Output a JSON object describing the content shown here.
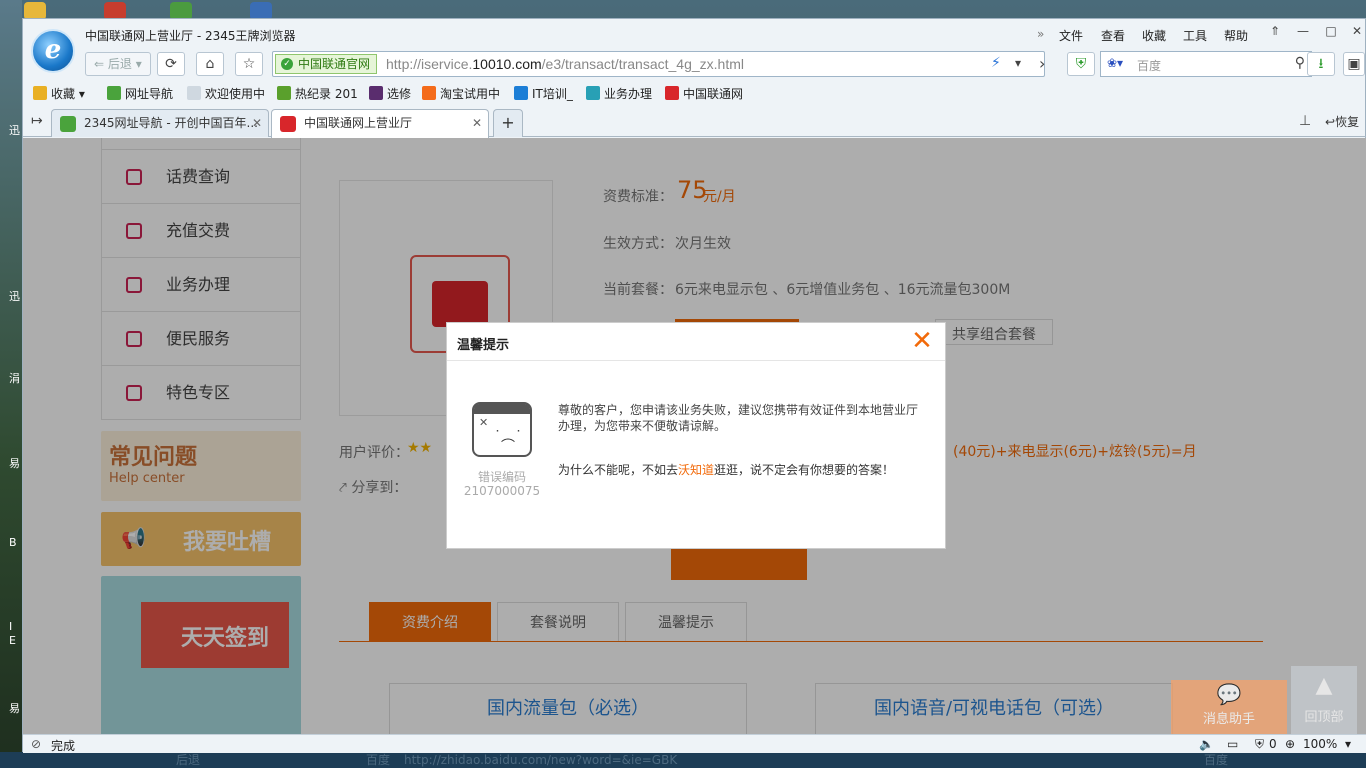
{
  "window": {
    "title": "中国联通网上营业厅 - 2345王牌浏览器",
    "menu": [
      "文件",
      "查看",
      "收藏",
      "工具",
      "帮助"
    ],
    "more_glyph": "»"
  },
  "navbar": {
    "back_label": "后退",
    "cert_label": "中国联通官网",
    "url_prefix": "http://iservice.",
    "url_domain": "10010.com",
    "url_suffix": "/e3/transact/transact_4g_zx.html",
    "search_placeholder": "百度"
  },
  "favorites": [
    {
      "label": "收藏",
      "color": "#e9b024"
    },
    {
      "label": "网址导航",
      "color": "#4aa33c"
    },
    {
      "label": "欢迎使用中",
      "color": "#cfd8e0"
    },
    {
      "label": "热纪录 201",
      "color": "#5aa02c"
    },
    {
      "label": "选修",
      "color": "#5a2d6e"
    },
    {
      "label": "淘宝试用中",
      "color": "#f46b1a"
    },
    {
      "label": "IT培训_",
      "color": "#1c7ed6"
    },
    {
      "label": "业务办理",
      "color": "#28a0b5"
    },
    {
      "label": "中国联通网",
      "color": "#d8262b"
    }
  ],
  "tabs": [
    {
      "label": "2345网址导航 - 开创中国百年...",
      "active": false
    },
    {
      "label": "中国联通网上营业厅",
      "active": true
    }
  ],
  "tabbar_right": {
    "restore_label": "恢复"
  },
  "sidebar": [
    {
      "label": "话费查询"
    },
    {
      "label": "充值交费"
    },
    {
      "label": "业务办理"
    },
    {
      "label": "便民服务"
    },
    {
      "label": "特色专区"
    }
  ],
  "promos": {
    "faq_title": "常见问题",
    "faq_sub": "Help center",
    "complain": "我要吐槽",
    "checkin": "天天签到"
  },
  "product": {
    "fee_label": "资费标准：",
    "fee_value": "75",
    "fee_unit": "元/月",
    "effect_label": "生效方式：",
    "effect_value": "次月生效",
    "current_label": "当前套餐：",
    "current_value": "6元来电显示包 、6元增值业务包 、16元流量包300M",
    "share_btn": "共享组合套餐",
    "rating_label": "用户评价：",
    "formula": "(40元)+来电显示(6元)+炫铃(5元)=月",
    "share_label": "分享到："
  },
  "section_tabs": [
    "资费介绍",
    "套餐说明",
    "温馨提示"
  ],
  "packages": [
    "国内流量包（必选）",
    "国内语音/可视电话包（可选）"
  ],
  "floats": {
    "assistant": "消息助手",
    "top": "回顶部"
  },
  "dialog": {
    "title": "温馨提示",
    "close_glyph": "✕",
    "error_label": "错误编码",
    "error_code": "2107000075",
    "message": "尊敬的客户，您申请该业务失败，建议您携带有效证件到本地营业厅办理，为您带来不便敬请谅解。",
    "suggest_pre": "为什么不能呢，不如去",
    "suggest_link": "沃知道",
    "suggest_post": "逛逛，说不定会有你想要的答案！"
  },
  "status": {
    "done": "完成",
    "count": "0",
    "zoom": "100%"
  },
  "taskbar_ghost": {
    "back": "后退",
    "engine": "百度",
    "url": "http://zhidao.baidu.com/new?word=&ie=GBK"
  },
  "desktop_chars": [
    "迅",
    "涓",
    "易",
    "B",
    "I",
    "E",
    "易"
  ]
}
